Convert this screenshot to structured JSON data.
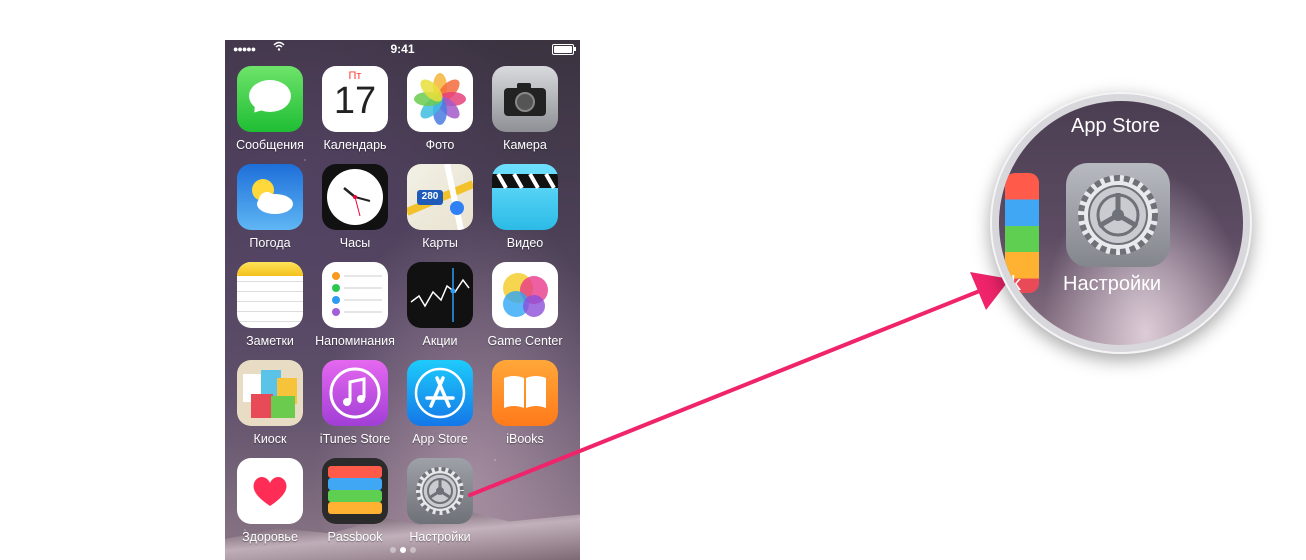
{
  "status_bar": {
    "signal": "●●●●●",
    "time": "9:41"
  },
  "home_screen": {
    "apps": [
      {
        "label": "Сообщения",
        "icon": "messages-icon"
      },
      {
        "label": "Календарь",
        "icon": "calendar-icon",
        "day": "Пт",
        "date": "17"
      },
      {
        "label": "Фото",
        "icon": "photos-icon"
      },
      {
        "label": "Камера",
        "icon": "camera-icon"
      },
      {
        "label": "Погода",
        "icon": "weather-icon"
      },
      {
        "label": "Часы",
        "icon": "clock-icon"
      },
      {
        "label": "Карты",
        "icon": "maps-icon",
        "sign": "280"
      },
      {
        "label": "Видео",
        "icon": "video-icon"
      },
      {
        "label": "Заметки",
        "icon": "notes-icon"
      },
      {
        "label": "Напоминания",
        "icon": "reminders-icon"
      },
      {
        "label": "Акции",
        "icon": "stocks-icon"
      },
      {
        "label": "Game Center",
        "icon": "game-center-icon"
      },
      {
        "label": "Киоск",
        "icon": "newsstand-icon"
      },
      {
        "label": "iTunes Store",
        "icon": "itunes-store-icon"
      },
      {
        "label": "App Store",
        "icon": "app-store-icon"
      },
      {
        "label": "iBooks",
        "icon": "ibooks-icon"
      },
      {
        "label": "Здоровье",
        "icon": "health-icon"
      },
      {
        "label": "Passbook",
        "icon": "passbook-icon"
      },
      {
        "label": "Настройки",
        "icon": "settings-icon"
      }
    ],
    "pages": 3,
    "current_page": 1
  },
  "magnifier": {
    "top_label": "App Store",
    "highlight_label": "Настройки",
    "left_fragment": "k"
  },
  "colors": {
    "arrow": "#f0246a"
  }
}
